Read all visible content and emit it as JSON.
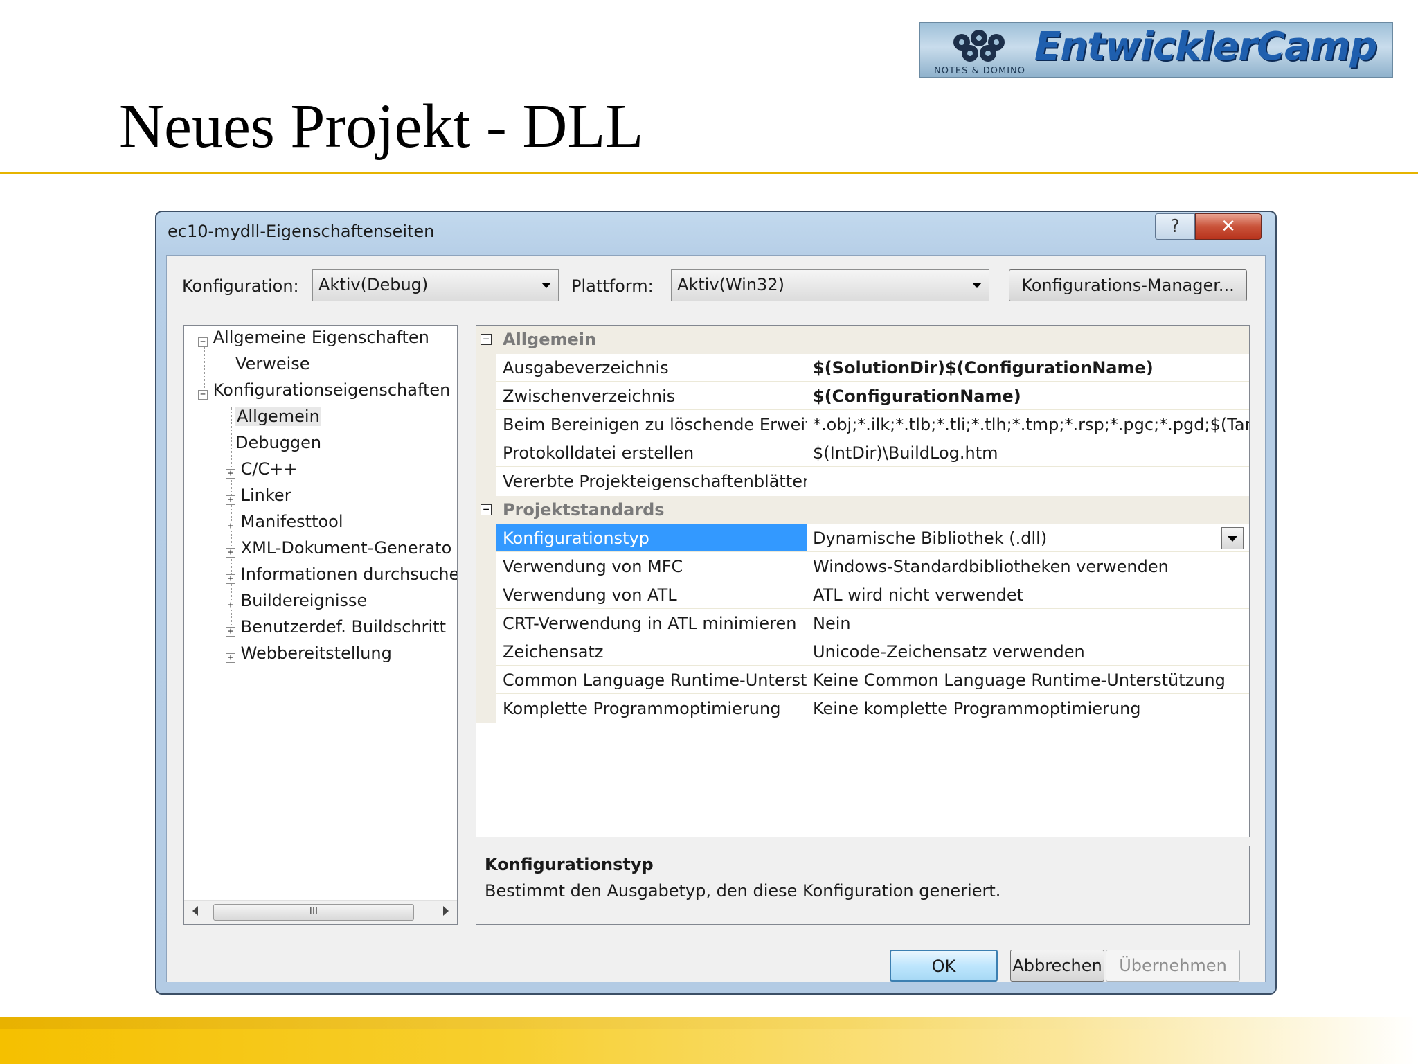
{
  "slide": {
    "title": "Neues Projekt - DLL",
    "logo_text": "EntwicklerCamp '10",
    "logo_subtext": "NOTES & DOMINO"
  },
  "dialog": {
    "title": "ec10-mydll-Eigenschaftenseiten",
    "help_label": "?",
    "close_label": "✕"
  },
  "toolbar": {
    "configuration_label": "Konfiguration:",
    "configuration_value": "Aktiv(Debug)",
    "platform_label": "Plattform:",
    "platform_value": "Aktiv(Win32)",
    "config_manager_label": "Konfigurations-Manager..."
  },
  "tree": {
    "items": [
      {
        "label": "Allgemeine Eigenschaften",
        "expander": "−"
      },
      {
        "label": "Verweise"
      },
      {
        "label": "Konfigurationseigenschaften",
        "expander": "−"
      },
      {
        "label": "Allgemein",
        "selected": true
      },
      {
        "label": "Debuggen"
      },
      {
        "label": "C/C++",
        "expander": "+"
      },
      {
        "label": "Linker",
        "expander": "+"
      },
      {
        "label": "Manifesttool",
        "expander": "+"
      },
      {
        "label": "XML-Dokument-Generato",
        "expander": "+"
      },
      {
        "label": "Informationen durchsuche",
        "expander": "+"
      },
      {
        "label": "Buildereignisse",
        "expander": "+"
      },
      {
        "label": "Benutzerdef. Buildschritt",
        "expander": "+"
      },
      {
        "label": "Webbereitstellung",
        "expander": "+"
      }
    ],
    "scroll_thumb": "III"
  },
  "grid": {
    "categories": [
      {
        "label": "Allgemein",
        "expander": "−"
      },
      {
        "label": "Projektstandards",
        "expander": "−"
      }
    ],
    "general_rows": [
      {
        "name": "Ausgabeverzeichnis",
        "value": "$(SolutionDir)$(ConfigurationName)",
        "bold": true
      },
      {
        "name": "Zwischenverzeichnis",
        "value": "$(ConfigurationName)",
        "bold": true
      },
      {
        "name": "Beim Bereinigen zu löschende Erweiteru",
        "value": "*.obj;*.ilk;*.tlb;*.tli;*.tlh;*.tmp;*.rsp;*.pgc;*.pgd;$(TargetP"
      },
      {
        "name": "Protokolldatei erstellen",
        "value": "$(IntDir)\\BuildLog.htm"
      },
      {
        "name": "Vererbte Projekteigenschaftenblätter",
        "value": ""
      }
    ],
    "defaults_rows": [
      {
        "name": "Konfigurationstyp",
        "value": "Dynamische Bibliothek (.dll)",
        "selected": true
      },
      {
        "name": "Verwendung von MFC",
        "value": "Windows-Standardbibliotheken verwenden"
      },
      {
        "name": "Verwendung von ATL",
        "value": "ATL wird nicht verwendet"
      },
      {
        "name": "CRT-Verwendung in ATL minimieren",
        "value": "Nein"
      },
      {
        "name": "Zeichensatz",
        "value": "Unicode-Zeichensatz verwenden"
      },
      {
        "name": "Common Language Runtime-Unterstü",
        "value": "Keine Common Language Runtime-Unterstützung"
      },
      {
        "name": "Komplette Programmoptimierung",
        "value": "Keine komplette Programmoptimierung"
      }
    ]
  },
  "description": {
    "title": "Konfigurationstyp",
    "text": "Bestimmt den Ausgabetyp, den diese Konfiguration generiert."
  },
  "buttons": {
    "ok": "OK",
    "cancel": "Abbrechen",
    "apply": "Übernehmen"
  },
  "colors": {
    "selection": "#3399ff",
    "accent_rule": "#e6b400",
    "dialog_frame": "#b7cfe7"
  }
}
